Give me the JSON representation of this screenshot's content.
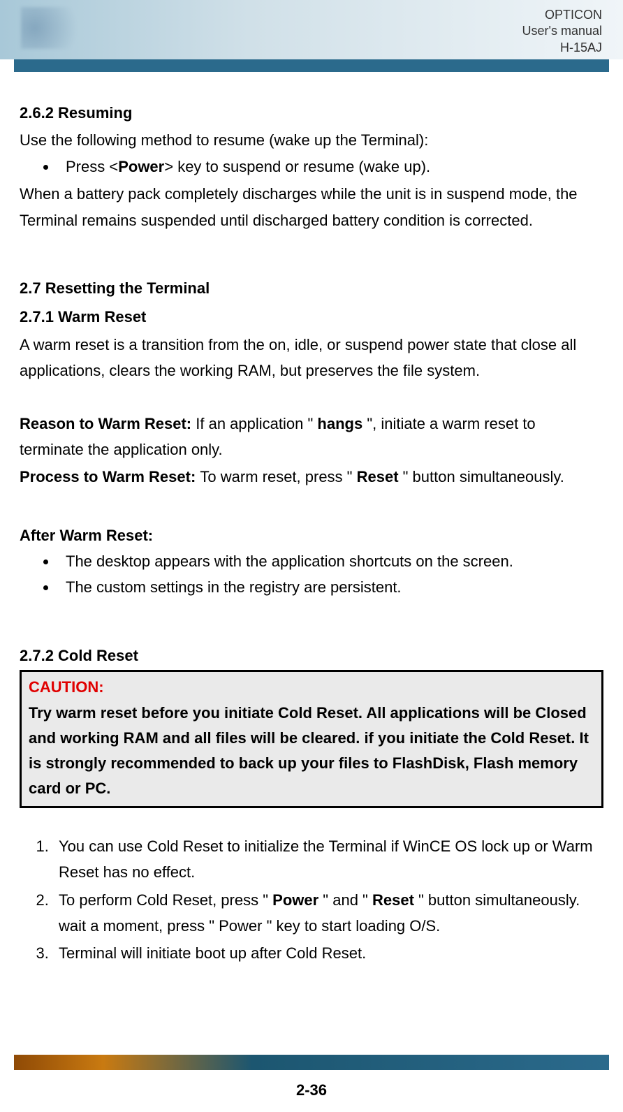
{
  "header": {
    "line1": "OPTICON",
    "line2": "User's manual",
    "line3": "H-15AJ"
  },
  "s262": {
    "heading": "2.6.2 Resuming",
    "intro": "Use the following method to resume (wake up the Terminal):",
    "bullet_pre": "Press <",
    "bullet_bold": "Power",
    "bullet_post": "> key to suspend or resume (wake up).",
    "after": "When a battery pack completely discharges while the unit is in suspend mode, the Terminal remains suspended until discharged battery condition is corrected."
  },
  "s27": {
    "heading": "2.7 Resetting the Terminal"
  },
  "s271": {
    "heading": "2.7.1 Warm Reset",
    "desc": "A warm reset is a transition from the on, idle, or suspend power state that close all applications, clears the working RAM, but preserves the file system.",
    "reason_label": "Reason to Warm Reset: ",
    "reason_pre": "If an application \" ",
    "reason_bold": "hangs",
    "reason_post": " \", initiate a warm reset to terminate the application only.",
    "process_label": "Process to Warm Reset: ",
    "process_pre": "To warm reset, press \" ",
    "process_bold": "Reset",
    "process_post": " \" button simultaneously.",
    "after_label": "After Warm Reset:",
    "after_bullets": [
      "The desktop appears with the application shortcuts on the screen.",
      "The custom settings in the registry are persistent."
    ]
  },
  "s272": {
    "heading": "2.7.2 Cold Reset",
    "caution_label": "CAUTION:",
    "caution_text": "Try warm reset before you initiate Cold Reset. All applications will be Closed and working RAM and all files will be cleared. if you initiate the Cold Reset. It is strongly recommended to back up your files to FlashDisk, Flash memory card or PC.",
    "step1": "You can use Cold Reset to initialize the Terminal if WinCE OS lock up or Warm Reset has no effect.",
    "step2_pre": "To perform Cold Reset, press \" ",
    "step2_bold1": "Power",
    "step2_mid": " \" and \" ",
    "step2_bold2": "Reset",
    "step2_post": " \" button simultaneously. wait a moment, press \" Power \" key to start loading O/S.",
    "step3": "Terminal will initiate boot up after Cold Reset."
  },
  "page_number": "2-36"
}
